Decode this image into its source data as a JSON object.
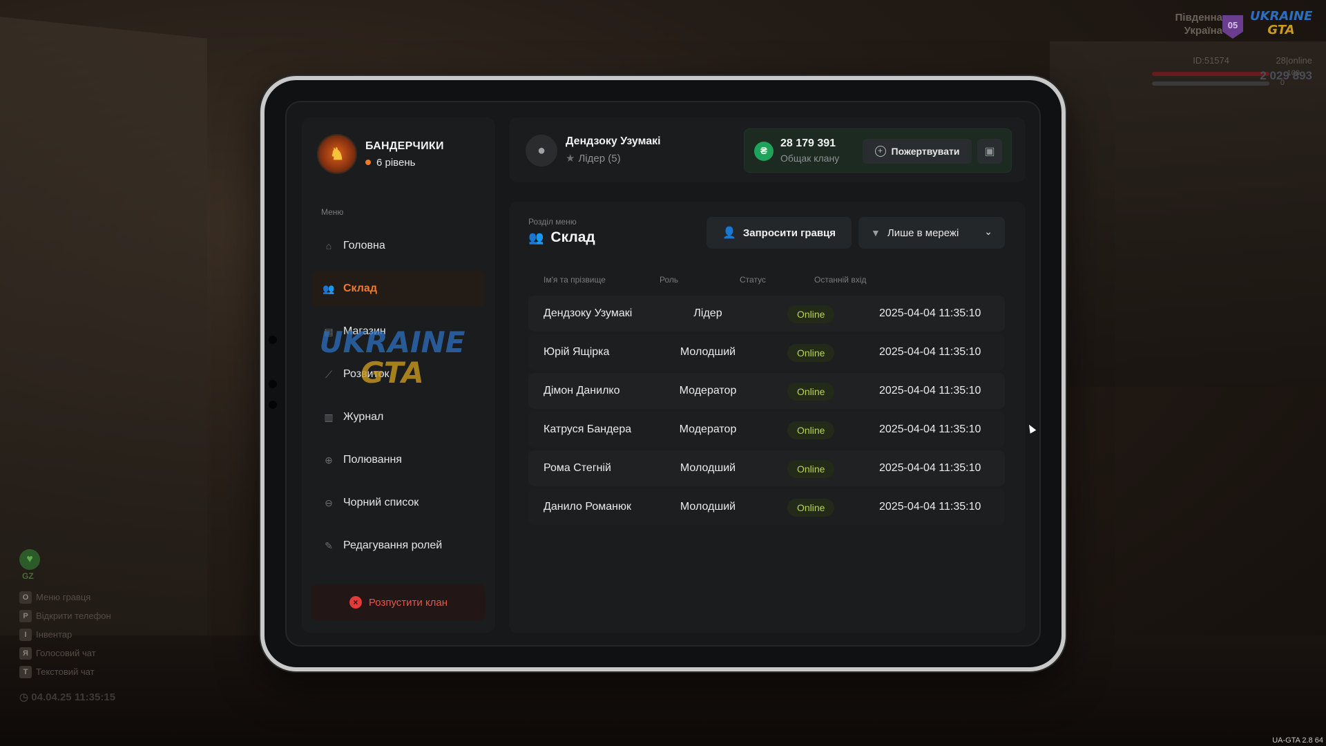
{
  "hud": {
    "server_name": "Південна Україна",
    "server_badge": "05",
    "logo_top": "UKRAINE",
    "logo_bottom": "GTA",
    "player_id": "ID:51574",
    "online": "28|online",
    "health_value": "100",
    "armor_value": "0",
    "money": "2 029 893",
    "hp_label": "GZ",
    "keys": [
      {
        "key": "O",
        "label": "Меню гравця"
      },
      {
        "key": "P",
        "label": "Відкрити телефон"
      },
      {
        "key": "I",
        "label": "Інвентар"
      },
      {
        "key": "Я",
        "label": "Голосовий чат"
      },
      {
        "key": "T",
        "label": "Текстовий чат"
      }
    ],
    "datetime": "04.04.25 11:35:15",
    "version": "UA-GTA 2.8   64"
  },
  "sidebar": {
    "clan_name": "БАНДЕРЧИКИ",
    "clan_level": "6 рівень",
    "menu_caption": "Меню",
    "items": [
      {
        "label": "Головна",
        "icon": "home-icon"
      },
      {
        "label": "Склад",
        "icon": "people-icon",
        "active": true
      },
      {
        "label": "Магазин",
        "icon": "basket-icon"
      },
      {
        "label": "Розвиток",
        "icon": "chart-icon"
      },
      {
        "label": "Журнал",
        "icon": "book-icon"
      },
      {
        "label": "Полювання",
        "icon": "crosshair-icon"
      },
      {
        "label": "Чорний список",
        "icon": "block-icon"
      },
      {
        "label": "Редагування ролей",
        "icon": "user-edit-icon"
      }
    ],
    "disband_label": "Розпустити клан"
  },
  "header": {
    "user_name": "Дендзоку Узумакі",
    "user_role": "Лідер (5)",
    "bank_amount": "28 179 391",
    "bank_label": "Общак клану",
    "donate_label": "Пожертвувати"
  },
  "section": {
    "caption": "Розділ меню",
    "title": "Склад",
    "invite_label": "Запросити гравця",
    "filter_value": "Лише в мережі"
  },
  "table": {
    "columns": [
      "Ім'я та прізвище",
      "Роль",
      "Статус",
      "Останній вхід"
    ],
    "rows": [
      {
        "name": "Дендзоку Узумакі",
        "role": "Лідер",
        "status": "Online",
        "last": "2025-04-04 11:35:10"
      },
      {
        "name": "Юрій Ящірка",
        "role": "Молодший",
        "status": "Online",
        "last": "2025-04-04 11:35:10"
      },
      {
        "name": "Дімон Данилко",
        "role": "Модератор",
        "status": "Online",
        "last": "2025-04-04 11:35:10"
      },
      {
        "name": "Катруся Бандера",
        "role": "Модератор",
        "status": "Online",
        "last": "2025-04-04 11:35:10"
      },
      {
        "name": "Рома Стегній",
        "role": "Молодший",
        "status": "Online",
        "last": "2025-04-04 11:35:10"
      },
      {
        "name": "Данило Романюк",
        "role": "Молодший",
        "status": "Online",
        "last": "2025-04-04 11:35:10"
      }
    ]
  },
  "watermark": {
    "top": "UKRAINE",
    "bottom": "GTA"
  },
  "colors": {
    "accent": "#f07a28",
    "online": "#b7d84a",
    "danger": "#e8554a",
    "bank": "#1fa35a"
  }
}
